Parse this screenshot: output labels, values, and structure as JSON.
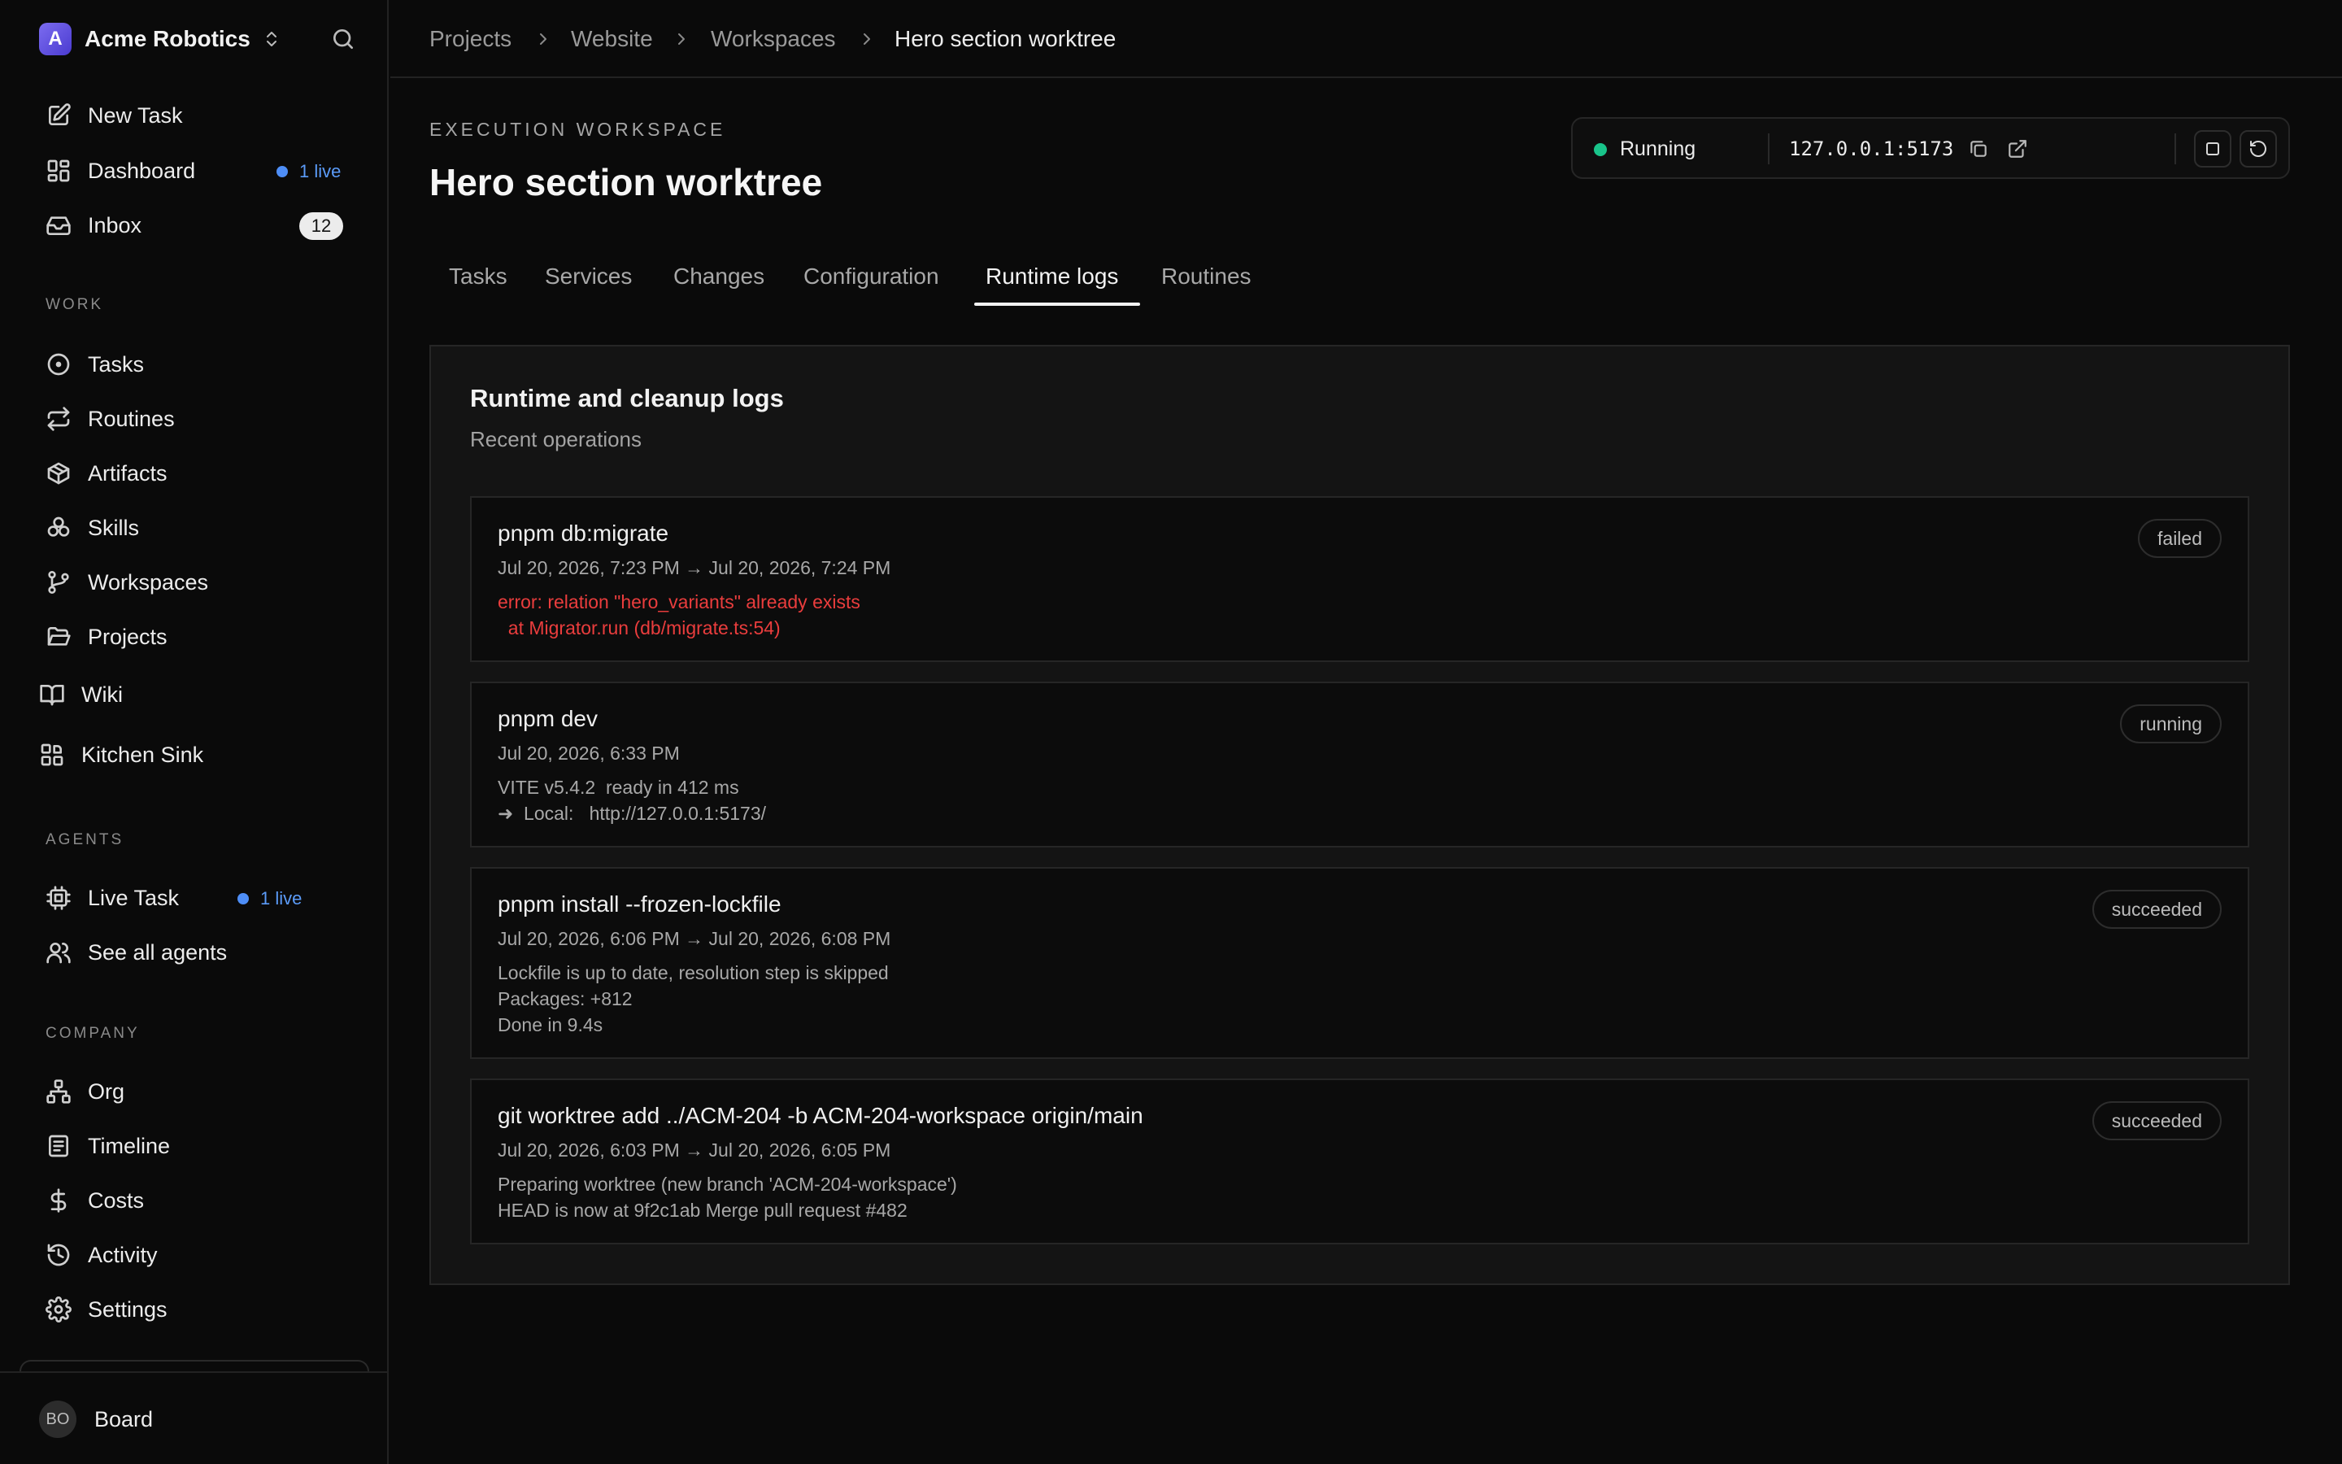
{
  "sidebar": {
    "brand": {
      "logo_letter": "A",
      "name": "Acme Robotics"
    },
    "top_items": [
      {
        "label": "New Task",
        "icon": "pencil-square-icon"
      },
      {
        "label": "Dashboard",
        "icon": "layout-grid-icon",
        "live": "1 live"
      },
      {
        "label": "Inbox",
        "icon": "inbox-icon",
        "count": "12"
      }
    ],
    "sections": {
      "work": "WORK",
      "agents": "AGENTS",
      "company": "COMPANY"
    },
    "work_items": [
      {
        "label": "Tasks",
        "icon": "circle-dot-icon"
      },
      {
        "label": "Routines",
        "icon": "repeat-icon"
      },
      {
        "label": "Artifacts",
        "icon": "package-icon"
      },
      {
        "label": "Skills",
        "icon": "boxes-icon"
      },
      {
        "label": "Workspaces",
        "icon": "git-branch-icon"
      },
      {
        "label": "Projects",
        "icon": "folder-open-icon"
      }
    ],
    "extra_items": [
      {
        "label": "Wiki",
        "icon": "book-open-icon"
      },
      {
        "label": "Kitchen Sink",
        "icon": "blocks-icon"
      }
    ],
    "agent_items": [
      {
        "label": "Live Task",
        "icon": "cpu-icon",
        "live": "1 live"
      },
      {
        "label": "See all agents",
        "icon": "users-icon"
      }
    ],
    "company_items": [
      {
        "label": "Org",
        "icon": "network-icon"
      },
      {
        "label": "Timeline",
        "icon": "scroll-text-icon"
      },
      {
        "label": "Costs",
        "icon": "dollar-icon"
      },
      {
        "label": "Activity",
        "icon": "history-icon"
      },
      {
        "label": "Settings",
        "icon": "gear-icon"
      }
    ],
    "footer": {
      "initials": "BO",
      "name": "Board"
    }
  },
  "breadcrumb": [
    "Projects",
    "Website",
    "Workspaces",
    "Hero section worktree"
  ],
  "header": {
    "eyebrow": "EXECUTION WORKSPACE",
    "title": "Hero section worktree"
  },
  "status": {
    "state": "Running",
    "state_color": "#19c48a",
    "url": "127.0.0.1:5173"
  },
  "tabs": [
    "Tasks",
    "Services",
    "Changes",
    "Configuration",
    "Runtime logs",
    "Routines"
  ],
  "active_tab": "Runtime logs",
  "logs": {
    "title": "Runtime and cleanup logs",
    "subtitle": "Recent operations",
    "error_color": "#ea3d3d",
    "entries": [
      {
        "command": "pnpm db:migrate",
        "time": "Jul 20, 2026, 7:23 PM → Jul 20, 2026, 7:24 PM",
        "output": "error: relation \"hero_variants\" already exists\n  at Migrator.run (db/migrate.ts:54)",
        "status": "failed"
      },
      {
        "command": "pnpm dev",
        "time": "Jul 20, 2026, 6:33 PM",
        "output": "VITE v5.4.2  ready in 412 ms\n➜  Local:   http://127.0.0.1:5173/",
        "status": "running"
      },
      {
        "command": "pnpm install --frozen-lockfile",
        "time": "Jul 20, 2026, 6:06 PM → Jul 20, 2026, 6:08 PM",
        "output": "Lockfile is up to date, resolution step is skipped\nPackages: +812\nDone in 9.4s",
        "status": "succeeded"
      },
      {
        "command": "git worktree add ../ACM-204 -b ACM-204-workspace origin/main",
        "time": "Jul 20, 2026, 6:03 PM → Jul 20, 2026, 6:05 PM",
        "output": "Preparing worktree (new branch 'ACM-204-workspace')\nHEAD is now at 9f2c1ab Merge pull request #482",
        "status": "succeeded"
      }
    ]
  }
}
